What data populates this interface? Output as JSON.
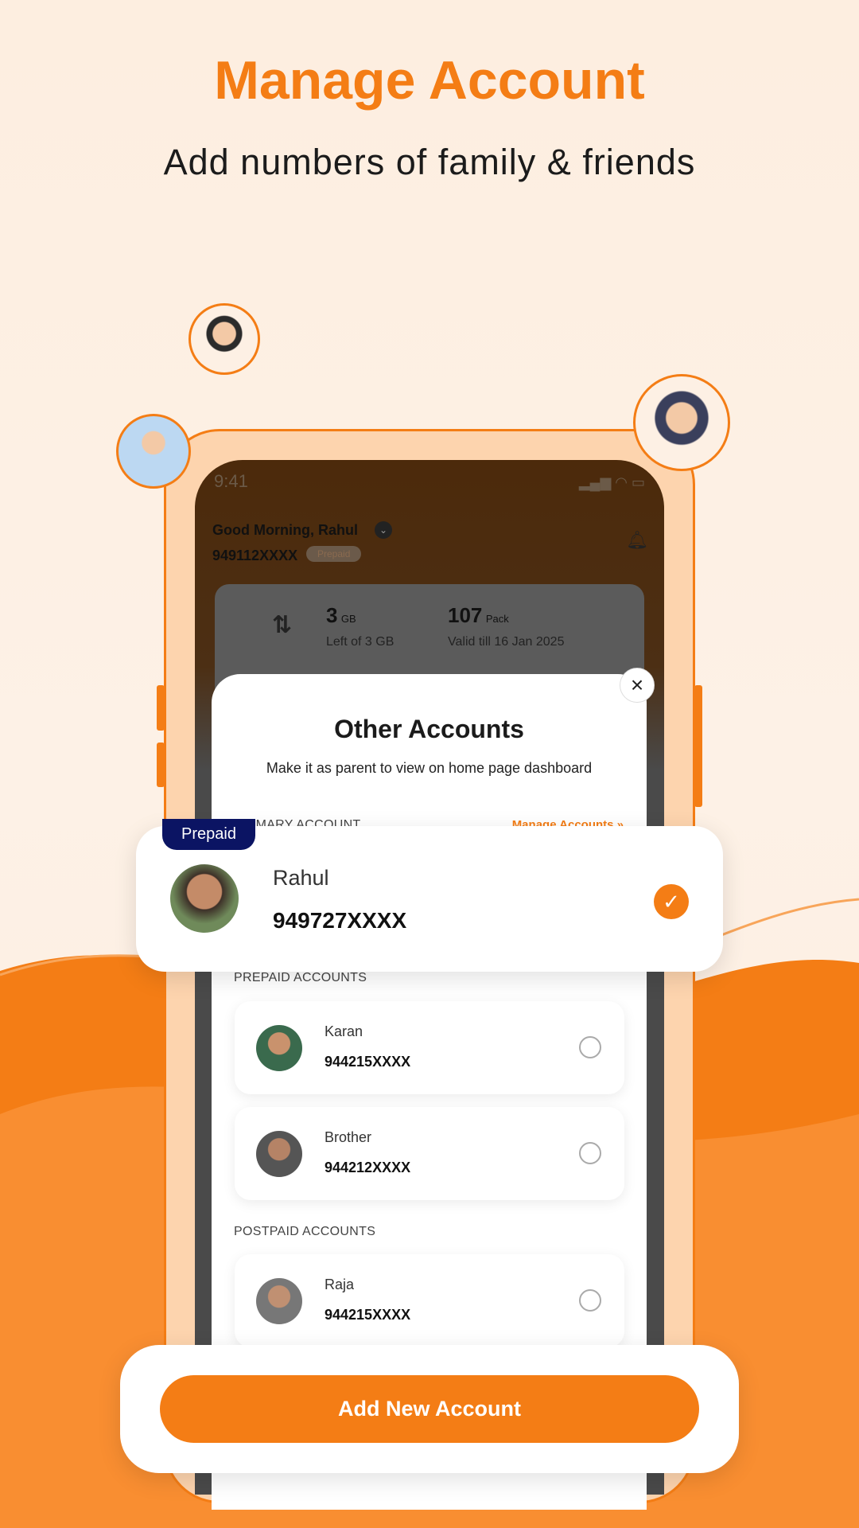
{
  "header": {
    "title": "Manage Account",
    "subtitle": "Add numbers of family & friends"
  },
  "colors": {
    "accent": "#f47d15",
    "tag": "#0b1463"
  },
  "phone": {
    "time": "9:41",
    "greeting": "Good Morning, Rahul",
    "number": "949112XXXX",
    "plan_badge": "Prepaid",
    "data": {
      "amount": "3",
      "unit": "GB",
      "caption": "Left of 3 GB"
    },
    "pack": {
      "amount": "107",
      "unit": "Pack",
      "caption": "Valid till 16 Jan 2025"
    }
  },
  "sheet": {
    "title": "Other Accounts",
    "description": "Make it as parent to view on home page dashboard",
    "primary_label": "PRIMARY ACCOUNT",
    "manage_link": "Manage Accounts  »",
    "primary": {
      "tag": "Prepaid",
      "name": "Rahul",
      "number": "949727XXXX",
      "selected": true
    },
    "prepaid_label": "PREPAID ACCOUNTS",
    "prepaid": [
      {
        "name": "Karan",
        "number": "944215XXXX"
      },
      {
        "name": "Brother",
        "number": "944212XXXX"
      }
    ],
    "postpaid_label": "POSTPAID ACCOUNTS",
    "postpaid": [
      {
        "name": "Raja",
        "number": "944215XXXX"
      }
    ]
  },
  "cta": {
    "label": "Add New Account"
  },
  "icons": {
    "close": "close-icon",
    "check": "check-icon",
    "bell": "bell-icon",
    "chevron": "chevron-down-icon",
    "data": "up-down-arrows-icon"
  }
}
